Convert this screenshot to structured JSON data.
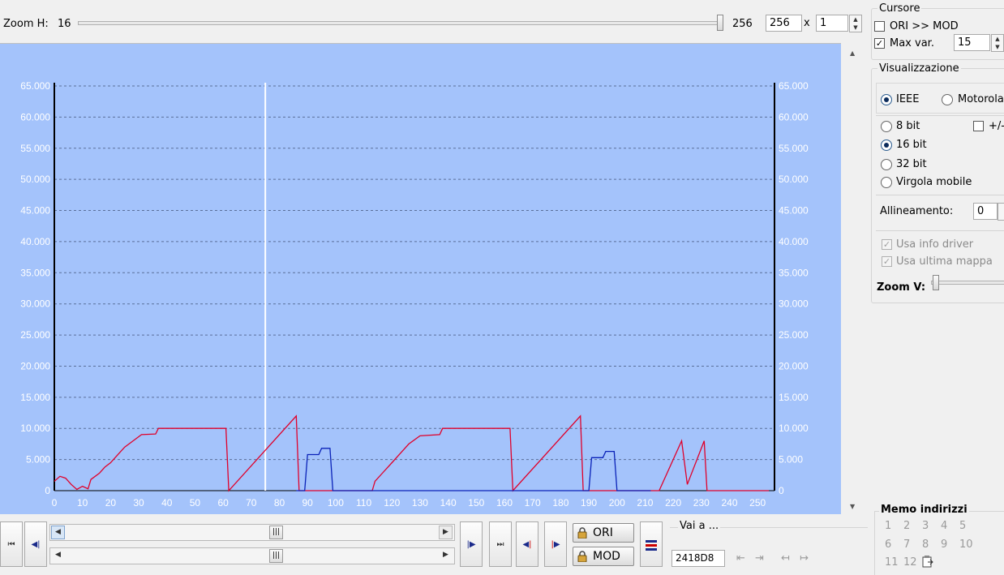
{
  "toolbar": {
    "zoom_h_label": "Zoom H:",
    "zoom_h_min": "16",
    "zoom_h_max": "256",
    "zoom_value": "256",
    "times": "x",
    "multiplier": "1"
  },
  "cursor_panel": {
    "title": "Cursore",
    "ori_mod_label": "ORI >> MOD",
    "ori_mod_checked": false,
    "max_var_label": "Max var.",
    "max_var_checked": true,
    "max_var_value": "15"
  },
  "visual_panel": {
    "title": "Visualizzazione",
    "byte_order": [
      "IEEE",
      "Motorola"
    ],
    "byte_order_selected": "IEEE",
    "bit_options": [
      "8 bit",
      "16 bit",
      "32 bit",
      "Virgola mobile"
    ],
    "bit_selected": "16 bit",
    "signed_label": "+/-",
    "alignment_label": "Allineamento:",
    "alignment_value": "0",
    "use_driver_label": "Usa info driver",
    "use_last_map_label": "Usa ultima mappa",
    "zoom_v_label": "Zoom V:"
  },
  "memo_panel": {
    "title": "Memo indirizzi",
    "slots": [
      "1",
      "2",
      "3",
      "4",
      "5",
      "6",
      "7",
      "8",
      "9",
      "10",
      "11",
      "12"
    ]
  },
  "nav": {
    "ori_label": "ORI",
    "mod_label": "MOD",
    "goto_label": "Vai a ...",
    "address_value": "2418D8"
  },
  "colors": {
    "plot_bg": "#a4c3fb",
    "ori_series": "#e0002a",
    "mod_series": "#0a22b8",
    "cursor_line": "#ffffff"
  },
  "chart_data": {
    "type": "line",
    "xlim": [
      0,
      256
    ],
    "ylim": [
      0,
      65000
    ],
    "x_ticks": [
      0,
      10,
      20,
      30,
      40,
      50,
      60,
      70,
      80,
      90,
      100,
      110,
      120,
      130,
      140,
      150,
      160,
      170,
      180,
      190,
      200,
      210,
      220,
      230,
      240,
      250
    ],
    "y_ticks": [
      "0",
      "5.000",
      "10.000",
      "15.000",
      "20.000",
      "25.000",
      "30.000",
      "35.000",
      "40.000",
      "45.000",
      "50.000",
      "55.000",
      "60.000",
      "65.000"
    ],
    "grid": "horizontal-dashed",
    "cursor_x": 75,
    "series": [
      {
        "color": "#e0002a",
        "points": [
          [
            0,
            1500
          ],
          [
            2,
            2300
          ],
          [
            4,
            2000
          ],
          [
            6,
            1000
          ],
          [
            8,
            200
          ],
          [
            10,
            700
          ],
          [
            12,
            300
          ],
          [
            13,
            1800
          ],
          [
            16,
            2800
          ],
          [
            18,
            3800
          ],
          [
            20,
            4500
          ],
          [
            22,
            5500
          ],
          [
            25,
            7000
          ],
          [
            28,
            8000
          ],
          [
            31,
            9000
          ],
          [
            36,
            9100
          ],
          [
            37,
            10000
          ],
          [
            45,
            10000
          ],
          [
            61,
            10000
          ],
          [
            62,
            0
          ],
          [
            86,
            12000
          ],
          [
            87,
            0
          ],
          [
            88,
            0
          ],
          [
            113,
            0
          ],
          [
            114,
            1500
          ],
          [
            117,
            3000
          ],
          [
            120,
            4500
          ],
          [
            123,
            6000
          ],
          [
            126,
            7500
          ],
          [
            130,
            8800
          ],
          [
            137,
            9000
          ],
          [
            138,
            10000
          ],
          [
            162,
            10000
          ],
          [
            163,
            0
          ],
          [
            187,
            12000
          ],
          [
            188,
            0
          ],
          [
            193,
            0
          ],
          [
            215,
            0
          ],
          [
            223,
            8000
          ],
          [
            225,
            1000
          ],
          [
            231,
            8000
          ],
          [
            232,
            0
          ],
          [
            254,
            0
          ]
        ]
      },
      {
        "color": "#0a22b8",
        "points": [
          [
            86,
            0
          ],
          [
            89,
            0
          ],
          [
            90,
            5800
          ],
          [
            94,
            5800
          ],
          [
            95,
            6800
          ],
          [
            98,
            6800
          ],
          [
            99,
            0
          ],
          [
            110,
            0
          ],
          [
            190,
            0
          ],
          [
            191,
            5300
          ],
          [
            195,
            5300
          ],
          [
            196,
            6300
          ],
          [
            199,
            6300
          ],
          [
            200,
            0
          ],
          [
            212,
            0
          ]
        ]
      }
    ]
  }
}
